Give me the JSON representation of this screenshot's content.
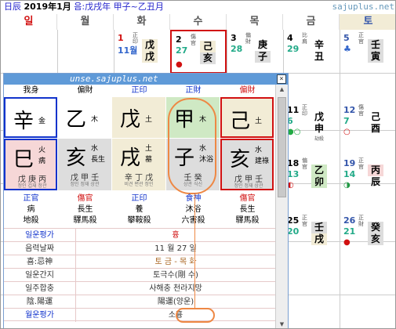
{
  "header": {
    "label": "日辰",
    "date": "2019年1月",
    "month_ganzhi": "음:戊戌年 甲子~乙丑月",
    "site": "sajuplus.net"
  },
  "weekdays": [
    {
      "label": "일",
      "color": "#d11111"
    },
    {
      "label": "월",
      "color": "#555555"
    },
    {
      "label": "화",
      "color": "#555555"
    },
    {
      "label": "수",
      "color": "#555555"
    },
    {
      "label": "목",
      "color": "#555555"
    },
    {
      "label": "금",
      "color": "#555555"
    },
    {
      "label": "토",
      "color": "#3355aa"
    }
  ],
  "calendar_cells": [
    {
      "day": "1",
      "lunar": "11월",
      "sinsal": "正印",
      "gz": [
        "戊",
        "戊"
      ],
      "sub": "",
      "color": "#d11111",
      "lunar_color": "#3366cc"
    },
    {
      "day": "2",
      "lunar": "27",
      "sinsal": "傷官",
      "gz": [
        "己",
        "亥"
      ],
      "sub": "",
      "color": "#000000",
      "lunar_color": "#22aa88"
    },
    {
      "day": "3",
      "lunar": "28",
      "sinsal": "偏財",
      "gz": [
        "庚",
        "子"
      ],
      "sub": "",
      "color": "#000000",
      "lunar_color": "#22aa88"
    },
    {
      "day": "4",
      "lunar": "29",
      "sinsal": "比肩",
      "gz": [
        "辛",
        "丑"
      ],
      "sub": "",
      "color": "#000000",
      "lunar_color": "#22aa88"
    },
    {
      "day": "5",
      "lunar": "♣",
      "sinsal": "正官",
      "gz": [
        "壬",
        "寅"
      ],
      "sub": "",
      "color": "#3355aa",
      "lunar_color": "#3366cc"
    },
    {
      "day": "11",
      "lunar": "6",
      "sinsal": "正印",
      "gz": [
        "戊",
        "申"
      ],
      "sub": "劫殺",
      "color": "#000000",
      "lunar_color": "#22aa88"
    },
    {
      "day": "12",
      "lunar": "7",
      "sinsal": "傷官",
      "gz": [
        "己",
        "酉"
      ],
      "sub": "",
      "color": "#3355aa",
      "lunar_color": "#22aa88"
    },
    {
      "day": "18",
      "lunar": "13",
      "sinsal": "偏官",
      "gz": [
        "乙",
        "卯"
      ],
      "sub": "桃花殺",
      "color": "#000000",
      "lunar_color": "#22aa88"
    },
    {
      "day": "19",
      "lunar": "14",
      "sinsal": "正官",
      "gz": [
        "丙",
        "辰"
      ],
      "sub": "",
      "color": "#3355aa",
      "lunar_color": "#22aa88"
    },
    {
      "day": "25",
      "lunar": "20",
      "sinsal": "正官",
      "gz": [
        "壬",
        "戌"
      ],
      "sub": "",
      "color": "#000000",
      "lunar_color": "#22aa88"
    },
    {
      "day": "26",
      "lunar": "21",
      "sinsal": "正財",
      "gz": [
        "癸",
        "亥"
      ],
      "sub": "",
      "color": "#3355aa",
      "lunar_color": "#22aa88"
    }
  ],
  "popup": {
    "title": "unse.sajuplus.net",
    "close_symbol": "×",
    "col_top": [
      "我身",
      "偏財",
      "正印",
      "正財",
      "偏財"
    ],
    "stems": [
      {
        "ch": "辛",
        "el": "金"
      },
      {
        "ch": "乙",
        "el": "木"
      },
      {
        "ch": "戊",
        "el": "土"
      },
      {
        "ch": "甲",
        "el": "木"
      },
      {
        "ch": "己",
        "el": "土"
      }
    ],
    "branches": [
      {
        "ch": "巳",
        "el1": "火",
        "el2": "病",
        "hid": "戊 庚 丙",
        "hidsub": "정인 겁재 정관"
      },
      {
        "ch": "亥",
        "el1": "水",
        "el2": "長生",
        "hid": "戊 甲 壬",
        "hidsub": "정인 정재 상관"
      },
      {
        "ch": "戌",
        "el1": "土",
        "el2": "墓",
        "hid": "辛 丁 戊",
        "hidsub": "비견 편관 정인"
      },
      {
        "ch": "子",
        "el1": "水",
        "el2": "沐浴",
        "hid": "壬 癸",
        "hidsub": "상관 식신"
      },
      {
        "ch": "亥",
        "el1": "水",
        "el2": "建祿",
        "hid": "戊 甲 壬",
        "hidsub": "정인 정재 상관"
      }
    ],
    "sipsin_row": [
      "正官",
      "傷官",
      "正印",
      "食神",
      "傷官"
    ],
    "unseong_row": [
      "病",
      "長生",
      "養",
      "沐浴",
      "長生"
    ],
    "sinsal_row": [
      "地殺",
      "驛馬殺",
      "攀鞍殺",
      "六害殺",
      "驛馬殺"
    ],
    "info": [
      {
        "label": "일운평가",
        "value": "흉"
      },
      {
        "label": "음력날짜",
        "value": "11 월 27 일"
      },
      {
        "label": "喜:忌神",
        "value": "토 금 - 목 화"
      },
      {
        "label": "일운간지",
        "value": "토극수(剛 수)"
      },
      {
        "label": "일주합충",
        "value": "사해충 천라지망"
      },
      {
        "label": "陰.陽運",
        "value": "陽運(양운)"
      },
      {
        "label": "월운평가",
        "value": "소흉"
      }
    ]
  },
  "colors": {
    "title_bar": "#5f9ad8",
    "red": "#d11111",
    "blue": "#1133cc",
    "highlight_circle": "#ee8844"
  }
}
